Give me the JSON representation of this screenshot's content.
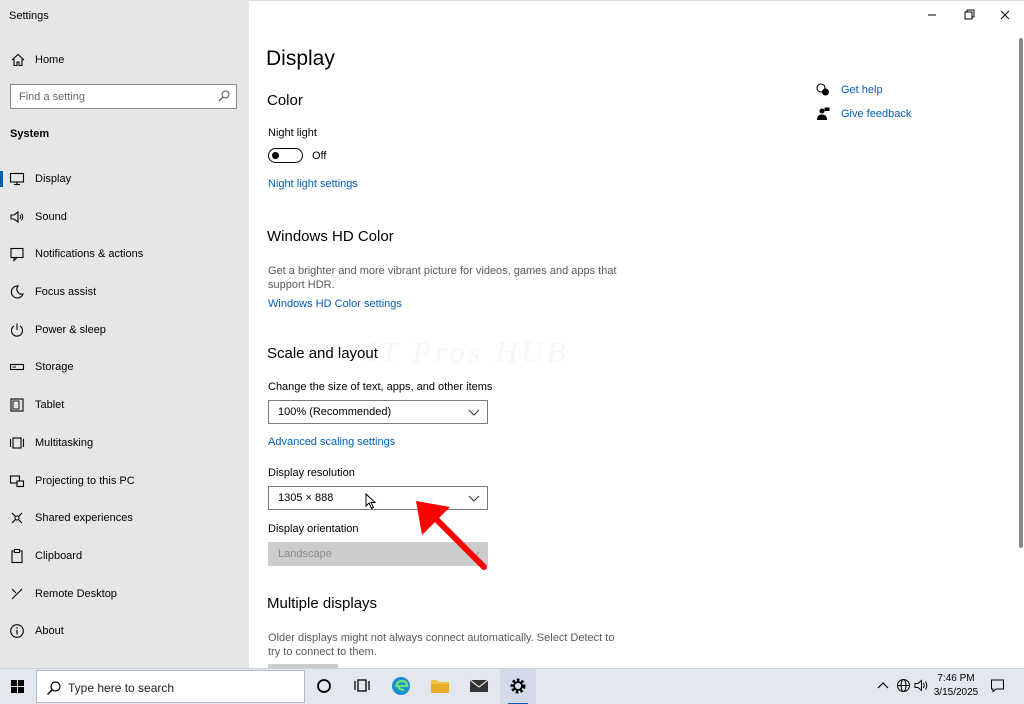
{
  "window": {
    "title": "Settings"
  },
  "sidebar": {
    "home_label": "Home",
    "search_placeholder": "Find a setting",
    "section_label": "System",
    "items": [
      {
        "label": "Display",
        "icon": "monitor-icon",
        "active": true
      },
      {
        "label": "Sound",
        "icon": "speaker-icon"
      },
      {
        "label": "Notifications & actions",
        "icon": "notification-icon"
      },
      {
        "label": "Focus assist",
        "icon": "moon-icon"
      },
      {
        "label": "Power & sleep",
        "icon": "power-icon"
      },
      {
        "label": "Storage",
        "icon": "storage-icon"
      },
      {
        "label": "Tablet",
        "icon": "tablet-icon"
      },
      {
        "label": "Multitasking",
        "icon": "multitasking-icon"
      },
      {
        "label": "Projecting to this PC",
        "icon": "projecting-icon"
      },
      {
        "label": "Shared experiences",
        "icon": "shared-experiences-icon"
      },
      {
        "label": "Clipboard",
        "icon": "clipboard-icon"
      },
      {
        "label": "Remote Desktop",
        "icon": "remote-desktop-icon"
      },
      {
        "label": "About",
        "icon": "info-icon"
      }
    ]
  },
  "main": {
    "title": "Display",
    "color": {
      "heading": "Color",
      "night_light_label": "Night light",
      "night_light_state": "Off",
      "night_light_link": "Night light settings"
    },
    "hdr": {
      "heading": "Windows HD Color",
      "description": "Get a brighter and more vibrant picture for videos, games and apps that support HDR.",
      "link": "Windows HD Color settings"
    },
    "scale": {
      "heading": "Scale and layout",
      "size_label": "Change the size of text, apps, and other items",
      "size_value": "100% (Recommended)",
      "advanced_link": "Advanced scaling settings",
      "resolution_label": "Display resolution",
      "resolution_value": "1305 × 888",
      "orientation_label": "Display orientation",
      "orientation_value": "Landscape"
    },
    "multiple": {
      "heading": "Multiple displays",
      "description": "Older displays might not always connect automatically. Select Detect to try to connect to them."
    },
    "watermark": "IT Pros HUB"
  },
  "help": {
    "get_help": "Get help",
    "give_feedback": "Give feedback"
  },
  "taskbar": {
    "search_placeholder": "Type here to search",
    "time": "7:46 PM",
    "date": "3/15/2025"
  },
  "colors": {
    "accent": "#005fb8",
    "annotation_arrow": "#ff0000"
  }
}
